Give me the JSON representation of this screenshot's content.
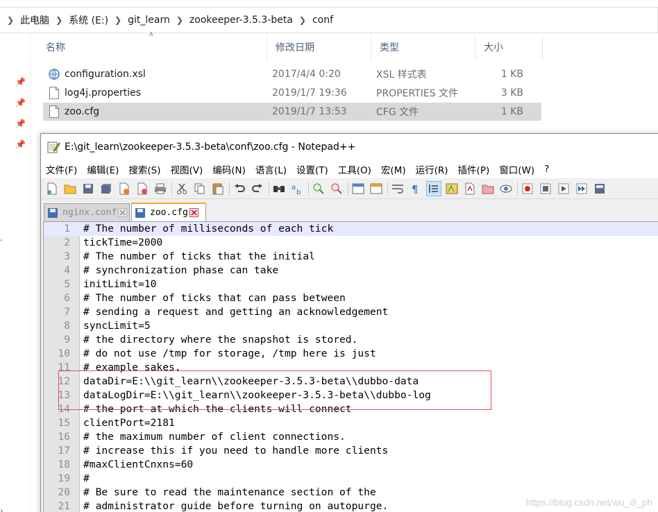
{
  "explorer": {
    "breadcrumb": [
      "此电脑",
      "系统 (E:)",
      "git_learn",
      "zookeeper-3.5.3-beta",
      "conf"
    ],
    "columns": {
      "name": "名称",
      "modified": "修改日期",
      "type": "类型",
      "size": "大小"
    },
    "files": [
      {
        "name": "configuration.xsl",
        "modified": "2017/4/4 0:20",
        "type": "XSL 样式表",
        "size": "1 KB",
        "icon": "xsl-file-icon"
      },
      {
        "name": "log4j.properties",
        "modified": "2019/1/7 19:36",
        "type": "PROPERTIES 文件",
        "size": "3 KB",
        "icon": "generic-file-icon"
      },
      {
        "name": "zoo.cfg",
        "modified": "2019/1/7 13:53",
        "type": "CFG 文件",
        "size": "1 KB",
        "icon": "generic-file-icon",
        "selected": true
      }
    ],
    "nav_edge_left_1": "-",
    "nav_edge_left_2": ")"
  },
  "notepad": {
    "title": "E:\\git_learn\\zookeeper-3.5.3-beta\\conf\\zoo.cfg - Notepad++",
    "menu": [
      "文件(F)",
      "编辑(E)",
      "搜索(S)",
      "视图(V)",
      "编码(N)",
      "语言(L)",
      "设置(T)",
      "工具(O)",
      "宏(M)",
      "运行(R)",
      "插件(P)",
      "窗口(W)",
      "?"
    ],
    "tabs": [
      {
        "label": "nginx.conf",
        "active": false
      },
      {
        "label": "zoo.cfg",
        "active": true
      }
    ],
    "lines": [
      {
        "n": "1",
        "text": "# The number of milliseconds of each tick"
      },
      {
        "n": "2",
        "text": "tickTime=2000"
      },
      {
        "n": "3",
        "text": "# The number of ticks that the initial"
      },
      {
        "n": "4",
        "text": "# synchronization phase can take"
      },
      {
        "n": "5",
        "text": "initLimit=10"
      },
      {
        "n": "6",
        "text": "# The number of ticks that can pass between"
      },
      {
        "n": "7",
        "text": "# sending a request and getting an acknowledgement"
      },
      {
        "n": "8",
        "text": "syncLimit=5"
      },
      {
        "n": "9",
        "text": "# the directory where the snapshot is stored."
      },
      {
        "n": "10",
        "text": "# do not use /tmp for storage, /tmp here is just"
      },
      {
        "n": "11",
        "text": "# example sakes."
      },
      {
        "n": "12",
        "text": "dataDir=E:\\\\git_learn\\\\zookeeper-3.5.3-beta\\\\dubbo-data"
      },
      {
        "n": "13",
        "text": "dataLogDir=E:\\\\git_learn\\\\zookeeper-3.5.3-beta\\\\dubbo-log"
      },
      {
        "n": "14",
        "text": "# the port at which the clients will connect"
      },
      {
        "n": "15",
        "text": "clientPort=2181"
      },
      {
        "n": "16",
        "text": "# the maximum number of client connections."
      },
      {
        "n": "17",
        "text": "# increase this if you need to handle more clients"
      },
      {
        "n": "18",
        "text": "#maxClientCnxns=60"
      },
      {
        "n": "19",
        "text": "#"
      },
      {
        "n": "20",
        "text": "# Be sure to read the maintenance section of the"
      },
      {
        "n": "21",
        "text": "# administrator guide before turning on autopurge."
      }
    ]
  },
  "watermark": "https://blog.csdn.net/wu_di_ph",
  "colors": {
    "highlight_box": "#e05050",
    "current_line": "#e8e8ff",
    "selected_file_row": "#d9d9d9",
    "active_tab_accent": "#f5a623"
  }
}
